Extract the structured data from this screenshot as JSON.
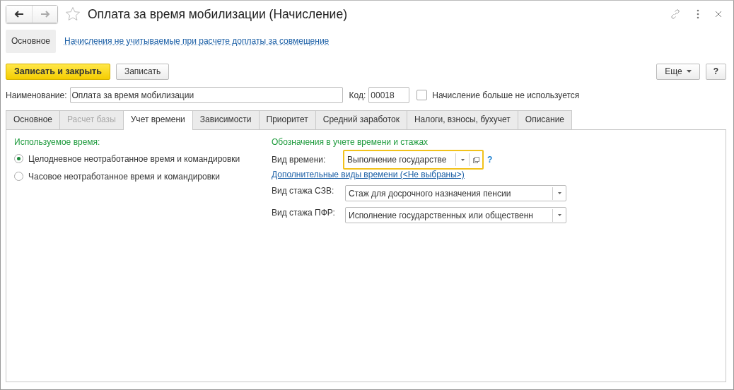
{
  "window": {
    "title": "Оплата за время мобилизации (Начисление)",
    "favorite": false
  },
  "sections": [
    {
      "label": "Основное",
      "selected": true
    },
    {
      "label": "Начисления не учитываемые при расчете доплаты за совмещение",
      "selected": false
    }
  ],
  "toolbar": {
    "buttons": [
      {
        "label": "Записать и закрыть",
        "kind": "primary"
      },
      {
        "label": "Записать",
        "kind": "plain"
      }
    ],
    "more": "Еще",
    "help": "?"
  },
  "name_field": {
    "label": "Наименование:",
    "value": "Оплата за время мобилизации"
  },
  "code_field": {
    "label": "Код:",
    "value": "00018"
  },
  "unused_checkbox": {
    "label": "Начисление больше не используется",
    "checked": false
  },
  "tabs": [
    {
      "label": "Основное",
      "selected": false,
      "disabled": false
    },
    {
      "label": "Расчет базы",
      "selected": false,
      "disabled": true
    },
    {
      "label": "Учет времени",
      "selected": true,
      "disabled": false
    },
    {
      "label": "Зависимости",
      "selected": false,
      "disabled": false
    },
    {
      "label": "Приоритет",
      "selected": false,
      "disabled": false
    },
    {
      "label": "Средний заработок",
      "selected": false,
      "disabled": false
    },
    {
      "label": "Налоги, взносы, бухучет",
      "selected": false,
      "disabled": false
    },
    {
      "label": "Описание",
      "selected": false,
      "disabled": false
    }
  ],
  "time_used": {
    "heading": "Используемое время:",
    "options": [
      {
        "label": "Целодневное неотработанное время и командировки",
        "selected": true
      },
      {
        "label": "Часовое неотработанное время и командировки",
        "selected": false
      }
    ]
  },
  "designations": {
    "heading": "Обозначения в учете времени и стажах",
    "time_kind": {
      "label": "Вид времени:",
      "value": "Выполнение государстве",
      "focused": true,
      "help": "?"
    },
    "extra_link": "Дополнительные виды времени (<Не выбраны>)",
    "fields": [
      {
        "label": "Вид стажа СЗВ:",
        "value": "Стаж для досрочного назначения пенсии"
      },
      {
        "label": "Вид стажа ПФР:",
        "value": "Исполнение государственных или общественн"
      }
    ]
  }
}
